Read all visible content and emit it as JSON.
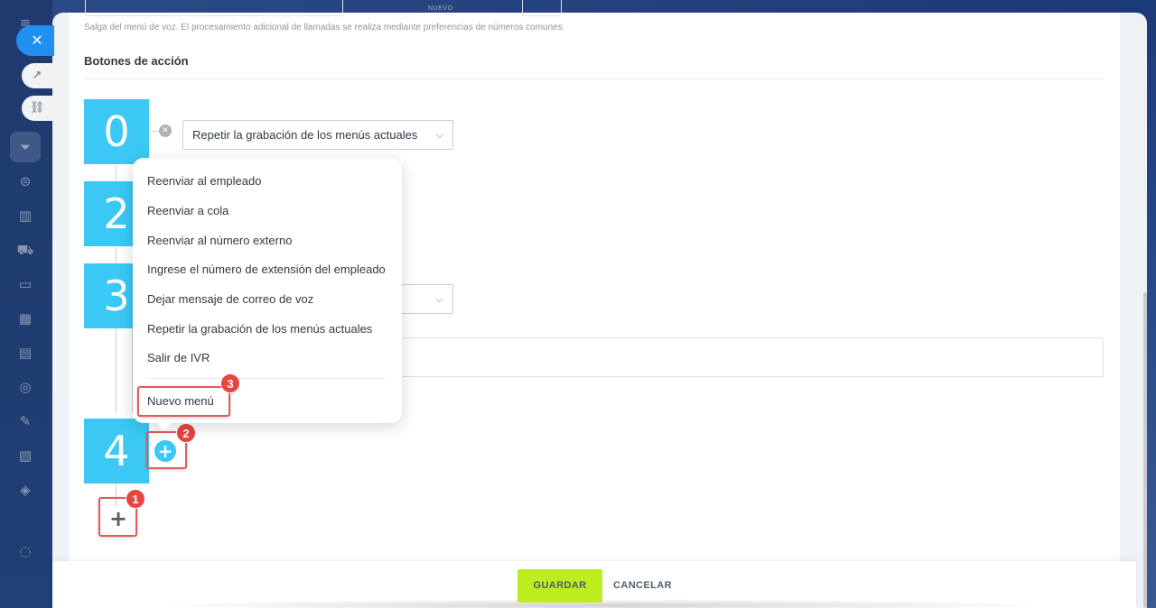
{
  "page": {
    "close_icon": "✕",
    "open_icon": "↗",
    "link_icon": "🔗"
  },
  "top": {
    "tiny_label": "NUEVO"
  },
  "section": {
    "hint": "Salga del menú de voz. El procesamiento adicional de llamadas se realiza mediante preferencias de números comunes.",
    "title": "Botones de acción"
  },
  "actions": [
    {
      "digit": "0",
      "value": "Repetir la grabación de los menús actuales"
    },
    {
      "digit": "2"
    },
    {
      "digit": "3"
    },
    {
      "digit": "4"
    }
  ],
  "menu": {
    "items": [
      "Reenviar al empleado",
      "Reenviar a cola",
      "Reenviar al número externo",
      "Ingrese el número de extensión del empleado",
      "Dejar mensaje de correo de voz",
      "Repetir la grabación de los menús actuales",
      "Salir de IVR"
    ],
    "new_menu": "Nuevo menú"
  },
  "badges": [
    "1",
    "2",
    "3"
  ],
  "footer": {
    "save": "GUARDAR",
    "cancel": "CANCELAR"
  },
  "colors": {
    "digit_bg": "#3bc8f5",
    "save_bg": "#bbed21",
    "highlight": "#e35a5a",
    "badge": "#e8453f"
  }
}
